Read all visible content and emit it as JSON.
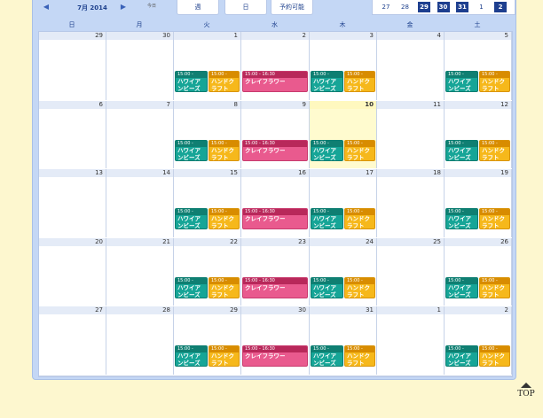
{
  "toolbar": {
    "prev_icon": "triangle-left-icon",
    "next_icon": "triangle-right-icon",
    "prev_glyph": "◀",
    "next_glyph": "▶",
    "month_label": "7月 2014",
    "today_label": "今日",
    "view_week": "週",
    "view_day": "日",
    "view_available": "予約可能"
  },
  "mini_days": [
    {
      "label": "27",
      "highlight": false
    },
    {
      "label": "28",
      "highlight": false
    },
    {
      "label": "29",
      "highlight": true
    },
    {
      "label": "30",
      "highlight": true
    },
    {
      "label": "31",
      "highlight": true
    },
    {
      "label": "1",
      "highlight": false
    },
    {
      "label": "2",
      "highlight": true
    }
  ],
  "weekday_headers": [
    "日",
    "月",
    "火",
    "水",
    "木",
    "金",
    "土"
  ],
  "weeks": [
    [
      "29",
      "30",
      "1",
      "2",
      "3",
      "4",
      "5"
    ],
    [
      "6",
      "7",
      "8",
      "9",
      "10",
      "11",
      "12"
    ],
    [
      "13",
      "14",
      "15",
      "16",
      "17",
      "18",
      "19"
    ],
    [
      "20",
      "21",
      "22",
      "23",
      "24",
      "25",
      "26"
    ],
    [
      "27",
      "28",
      "29",
      "30",
      "31",
      "1",
      "2"
    ]
  ],
  "today": {
    "week": 1,
    "day": 4
  },
  "events": {
    "hawaiian_time": "15:00 -",
    "hawaiian_name": "ハワイアンビーズ",
    "handcraft_time": "15:00 -",
    "handcraft_name": "ハンドクラフト",
    "clay_time": "15:00 - 16:30",
    "clay_name": "クレイフラワー"
  },
  "colors": {
    "teal": "#16a597",
    "orange": "#f6b81b",
    "pink": "#e95a8e"
  },
  "footer": {
    "top_label": "TOP",
    "top_icon": "up-arrow-icon"
  }
}
